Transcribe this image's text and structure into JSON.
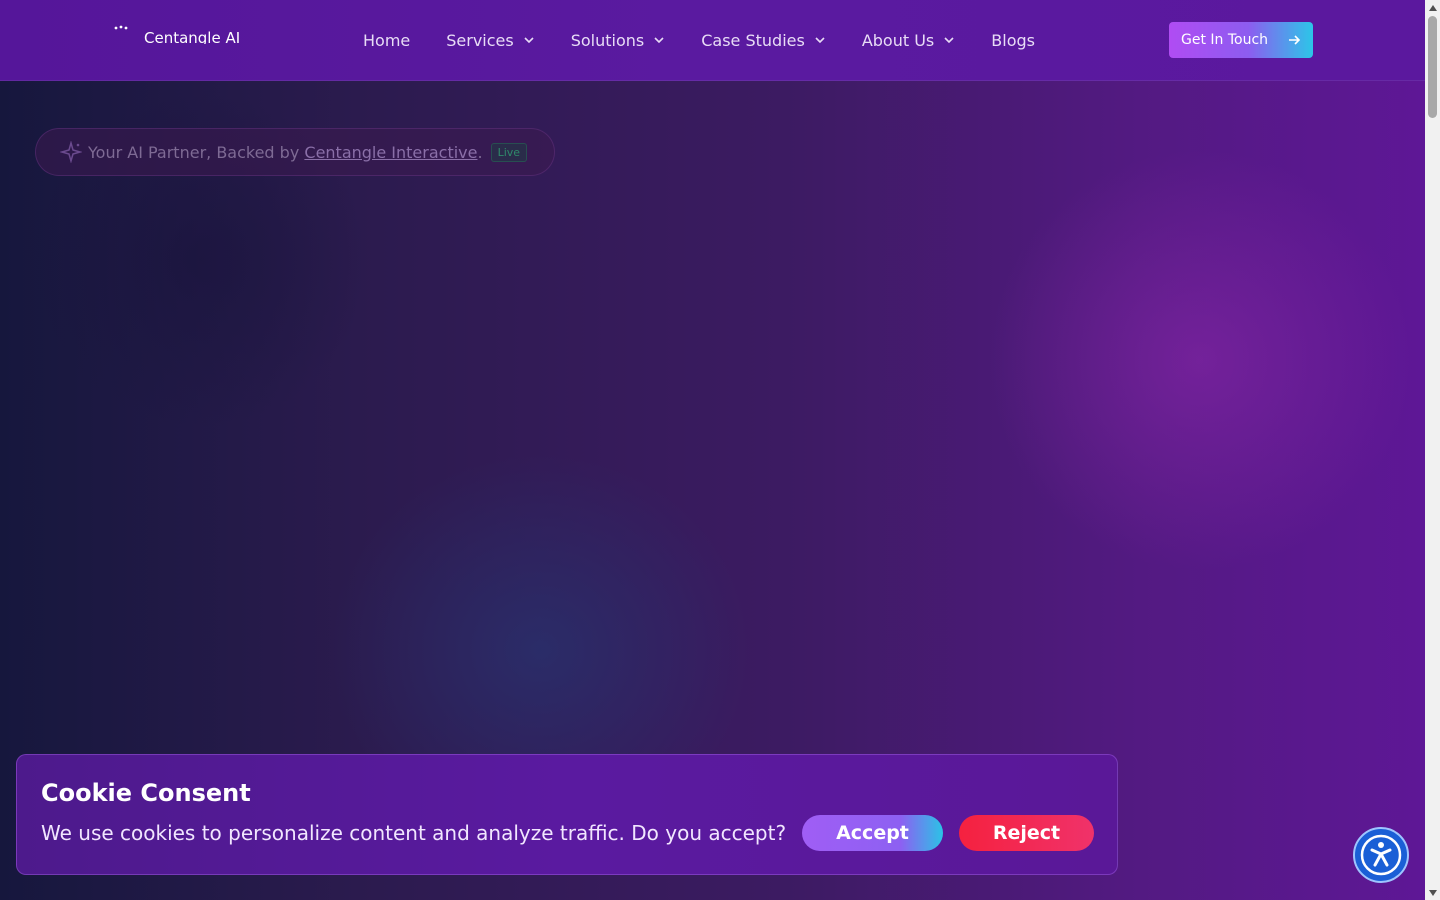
{
  "header": {
    "logo_text": "Centangle AI",
    "nav": [
      {
        "label": "Home",
        "has_dropdown": false
      },
      {
        "label": "Services",
        "has_dropdown": true
      },
      {
        "label": "Solutions",
        "has_dropdown": true
      },
      {
        "label": "Case Studies",
        "has_dropdown": true
      },
      {
        "label": "About Us",
        "has_dropdown": true
      },
      {
        "label": "Blogs",
        "has_dropdown": false
      }
    ],
    "cta_label": "Get In Touch"
  },
  "hero": {
    "badge_prefix": "Your AI Partner, Backed by ",
    "badge_link": "Centangle Interactive",
    "badge_suffix": ".",
    "badge_status": "Live"
  },
  "cookie": {
    "title": "Cookie Consent",
    "message": "We use cookies to personalize content and analyze traffic. Do you accept?",
    "accept_label": "Accept",
    "reject_label": "Reject"
  },
  "icons": {
    "nav_dropdown": "chevron-down-icon",
    "cta": "arrow-right-icon",
    "badge": "sparkle-icon",
    "accessibility": "accessibility-icon"
  },
  "colors": {
    "header_bg": "#5a1aa0",
    "cta_gradient_start": "#b04cf3",
    "cta_gradient_end": "#2cc6e8",
    "reject": "#f5213f",
    "accessibility": "#1a5fd6"
  }
}
